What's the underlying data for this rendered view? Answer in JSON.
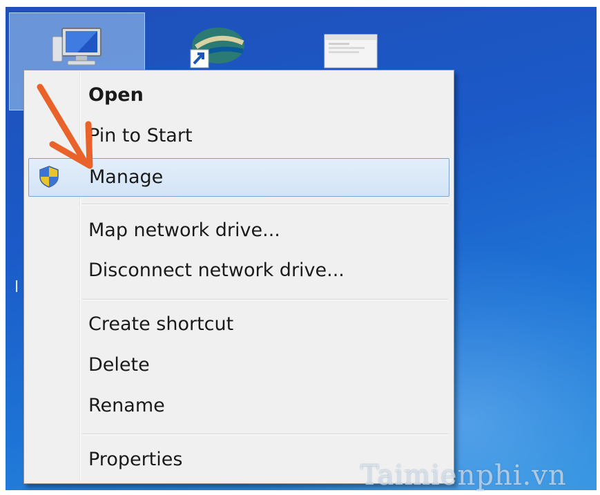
{
  "desktop": {
    "icons": [
      "computer-icon",
      "network-shortcut-icon",
      "window-icon"
    ],
    "partial_label": "l"
  },
  "context_menu": {
    "items": [
      {
        "label": "Open",
        "default": true
      },
      {
        "label": "Pin to Start"
      },
      {
        "label": "Manage",
        "icon": "uac-shield-icon",
        "highlighted": true
      },
      {
        "label": "Map network drive..."
      },
      {
        "label": "Disconnect network drive..."
      },
      {
        "label": "Create shortcut"
      },
      {
        "label": "Delete"
      },
      {
        "label": "Rename"
      },
      {
        "label": "Properties"
      }
    ]
  },
  "annotation": {
    "color": "#e8622a",
    "icon": "arrow-pointer"
  },
  "watermark": "Taimienphi.vn"
}
